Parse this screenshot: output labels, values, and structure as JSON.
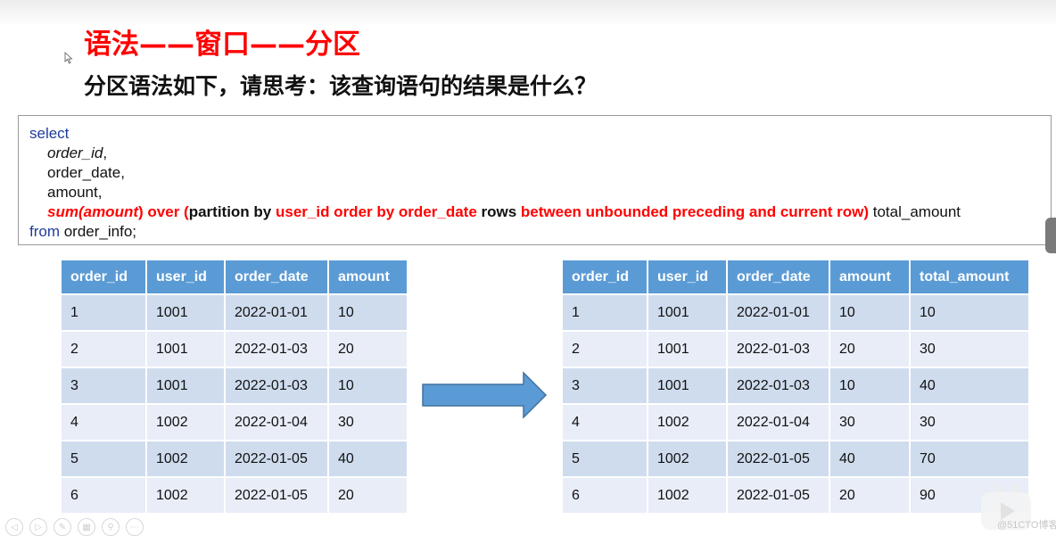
{
  "slide": {
    "title": "语法——窗口——分区",
    "subtitle": "分区语法如下，请思考：该查询语句的结果是什么？"
  },
  "code": {
    "line1": "select",
    "line2_col": "order_id",
    "line2_comma": ",",
    "line3": "order_date,",
    "line4": "amount,",
    "line5": {
      "fn": "sum(amount",
      "close_paren": ")",
      "over": " over (",
      "partition": "partition by ",
      "user_id": "user_id order by order_date",
      "rows": " rows ",
      "frame": "between unbounded preceding and current row)",
      "alias": " total_amount"
    },
    "line6_kw": "from",
    "line6_rest": " order_info;"
  },
  "left_table": {
    "headers": [
      "order_id",
      "user_id",
      "order_date",
      "amount"
    ],
    "rows": [
      [
        "1",
        "1001",
        "2022-01-01",
        "10"
      ],
      [
        "2",
        "1001",
        "2022-01-03",
        "20"
      ],
      [
        "3",
        "1001",
        "2022-01-03",
        "10"
      ],
      [
        "4",
        "1002",
        "2022-01-04",
        "30"
      ],
      [
        "5",
        "1002",
        "2022-01-05",
        "40"
      ],
      [
        "6",
        "1002",
        "2022-01-05",
        "20"
      ]
    ]
  },
  "right_table": {
    "headers": [
      "order_id",
      "user_id",
      "order_date",
      "amount",
      "total_amount"
    ],
    "rows": [
      [
        "1",
        "1001",
        "2022-01-01",
        "10",
        "10"
      ],
      [
        "2",
        "1001",
        "2022-01-03",
        "20",
        "30"
      ],
      [
        "3",
        "1001",
        "2022-01-03",
        "10",
        "40"
      ],
      [
        "4",
        "1002",
        "2022-01-04",
        "30",
        "30"
      ],
      [
        "5",
        "1002",
        "2022-01-05",
        "40",
        "70"
      ],
      [
        "6",
        "1002",
        "2022-01-05",
        "20",
        "90"
      ]
    ]
  },
  "player_controls": [
    {
      "name": "previous-slide-button",
      "icon": "arrow-left-icon",
      "glyph": "◁"
    },
    {
      "name": "next-slide-button",
      "icon": "arrow-right-icon",
      "glyph": "▷"
    },
    {
      "name": "pen-button",
      "icon": "pen-icon",
      "glyph": "✎"
    },
    {
      "name": "slides-overview-button",
      "icon": "grid-icon",
      "glyph": "▦"
    },
    {
      "name": "zoom-button",
      "icon": "magnifier-icon",
      "glyph": "⚲"
    },
    {
      "name": "more-button",
      "icon": "more-icon",
      "glyph": "⋯"
    }
  ],
  "watermark": "@51CTO博客",
  "colors": {
    "title_red": "#ff0000",
    "keyword_blue": "#1f3c9c",
    "header_blue": "#5b9bd5",
    "row_odd": "#cfdcee",
    "row_even": "#e8edf7"
  }
}
